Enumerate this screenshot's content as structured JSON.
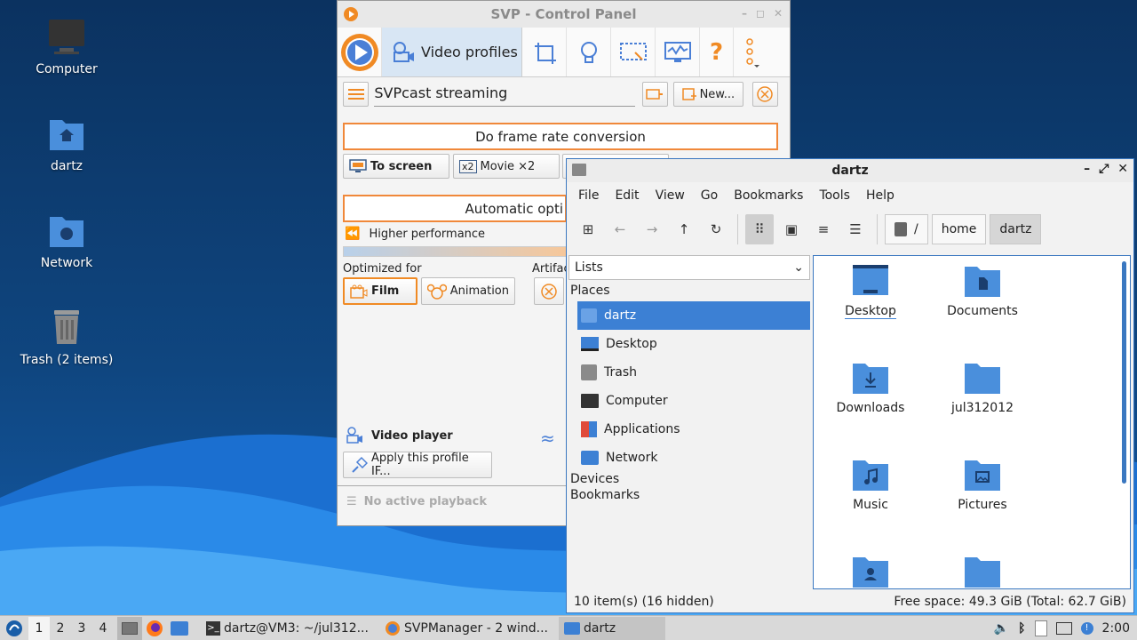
{
  "desktop": {
    "icons": [
      {
        "label": "Computer"
      },
      {
        "label": "dartz"
      },
      {
        "label": "Network"
      },
      {
        "label": "Trash (2 items)"
      }
    ]
  },
  "svp": {
    "title": "SVP - Control Panel",
    "active_tab": "Video profiles",
    "profile_name": "SVPcast streaming",
    "new_button": "New...",
    "frame_rate_button": "Do frame rate conversion",
    "to_screen": "To screen",
    "movie_x2": "Movie ×2",
    "x2_badge": "x2",
    "automatic_opt": "Automatic opti",
    "higher_performance": "Higher performance",
    "optimized_for": "Optimized for",
    "artifacts": "Artifac",
    "film": "Film",
    "animation": "Animation",
    "video_player": "Video player",
    "apply_profile": "Apply this profile IF...",
    "no_playback": "No active playback"
  },
  "fm": {
    "title": "dartz",
    "menu": [
      "File",
      "Edit",
      "View",
      "Go",
      "Bookmarks",
      "Tools",
      "Help"
    ],
    "breadcrumbs": [
      "/",
      "home",
      "dartz"
    ],
    "side_select": "Lists",
    "places_header": "Places",
    "places": [
      "dartz",
      "Desktop",
      "Trash",
      "Computer",
      "Applications",
      "Network"
    ],
    "devices_header": "Devices",
    "bookmarks_header": "Bookmarks",
    "files": [
      "Desktop",
      "Documents",
      "Downloads",
      "jul312012",
      "Music",
      "Pictures"
    ],
    "status_left": "10 item(s) (16 hidden)",
    "status_right": "Free space: 49.3 GiB (Total: 62.7 GiB)"
  },
  "taskbar": {
    "workspaces": [
      "1",
      "2",
      "3",
      "4"
    ],
    "tasks": [
      "dartz@VM3: ~/jul312...",
      "SVPManager - 2 wind...",
      "dartz"
    ],
    "clock": "2:00"
  },
  "colors": {
    "accent": "#3c80d4",
    "svp_orange": "#f0883a",
    "folder": "#4a8fdc"
  }
}
